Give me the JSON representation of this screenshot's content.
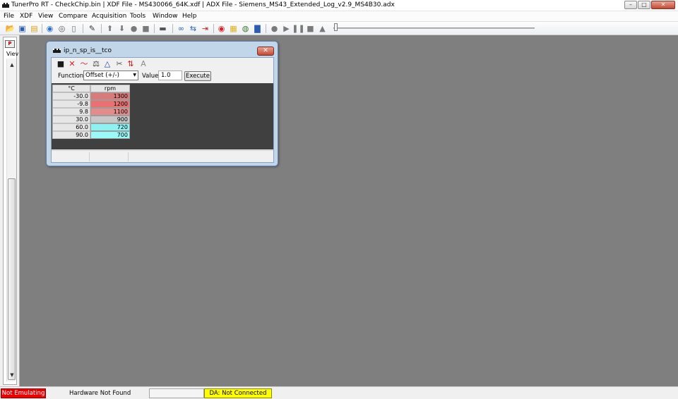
{
  "window": {
    "title": "TunerPro RT - CheckChip.bin | XDF File - MS430066_64K.xdf | ADX File - Siemens_MS43_Extended_Log_v2.9_MS4B30.adx",
    "min_glyph": "–",
    "max_glyph": "□",
    "close_glyph": "✕"
  },
  "menu": {
    "file": "File",
    "xdf": "XDF",
    "view": "View",
    "compare": "Compare",
    "acquisition": "Acquisition",
    "tools": "Tools",
    "window": "Window",
    "help": "Help"
  },
  "toolbar_icons": {
    "open": "open-folder-icon",
    "save": "save-icon",
    "folder": "folder-icon",
    "chip_read": "chip-read-icon",
    "chip_write": "chip-write-icon",
    "new_doc": "new-document-icon",
    "edit": "edit-icon",
    "up": "arrow-up-icon",
    "down": "arrow-down-icon",
    "record": "record-icon",
    "copy": "copy-icon",
    "chip": "chip-icon",
    "link": "link-icon",
    "swap": "swap-icon",
    "import": "import-icon",
    "target": "target-icon",
    "notes": "notes-icon",
    "globe": "globe-icon",
    "chart": "chart-icon",
    "play_record": "record-circle-icon",
    "play": "play-icon",
    "pause": "pause-icon",
    "stop": "stop-icon",
    "eject": "eject-icon"
  },
  "left_panel": {
    "label": "Viev",
    "up_arrow": "▲",
    "down_arrow": "▼",
    "grip": "≡"
  },
  "table_window": {
    "title": "ip_n_sp_is__tco",
    "close_glyph": "✕",
    "function_label": "Function:",
    "function_value": "Offset (+/-)",
    "dropdown_arrow": "▼",
    "value_label": "Value:",
    "value_input": "1.0",
    "execute_label": "Execute",
    "tools": {
      "save": "■",
      "delete": "✕",
      "graph": "〜",
      "scale": "⚖",
      "compare": "△",
      "cut": "✂",
      "arrows": "⇅",
      "font": "A"
    },
    "table": {
      "row_header": "°C",
      "col_header": "rpm",
      "rows": [
        {
          "temp": "-30.0",
          "rpm": "1300",
          "color": "#d97b7b"
        },
        {
          "temp": "-9.8",
          "rpm": "1200",
          "color": "#ed7070"
        },
        {
          "temp": "9.8",
          "rpm": "1100",
          "color": "#e48c8c"
        },
        {
          "temp": "30.0",
          "rpm": "900",
          "color": "#c7c7c7"
        },
        {
          "temp": "60.0",
          "rpm": "720",
          "color": "#8df2f2"
        },
        {
          "temp": "90.0",
          "rpm": "700",
          "color": "#9afafa"
        }
      ]
    }
  },
  "statusbar": {
    "emulation": "Not Emulating",
    "hardware": "Hardware Not Found",
    "da": "DA: Not Connected",
    "emulation_color": "#ee0000",
    "da_color": "#ffff00"
  }
}
